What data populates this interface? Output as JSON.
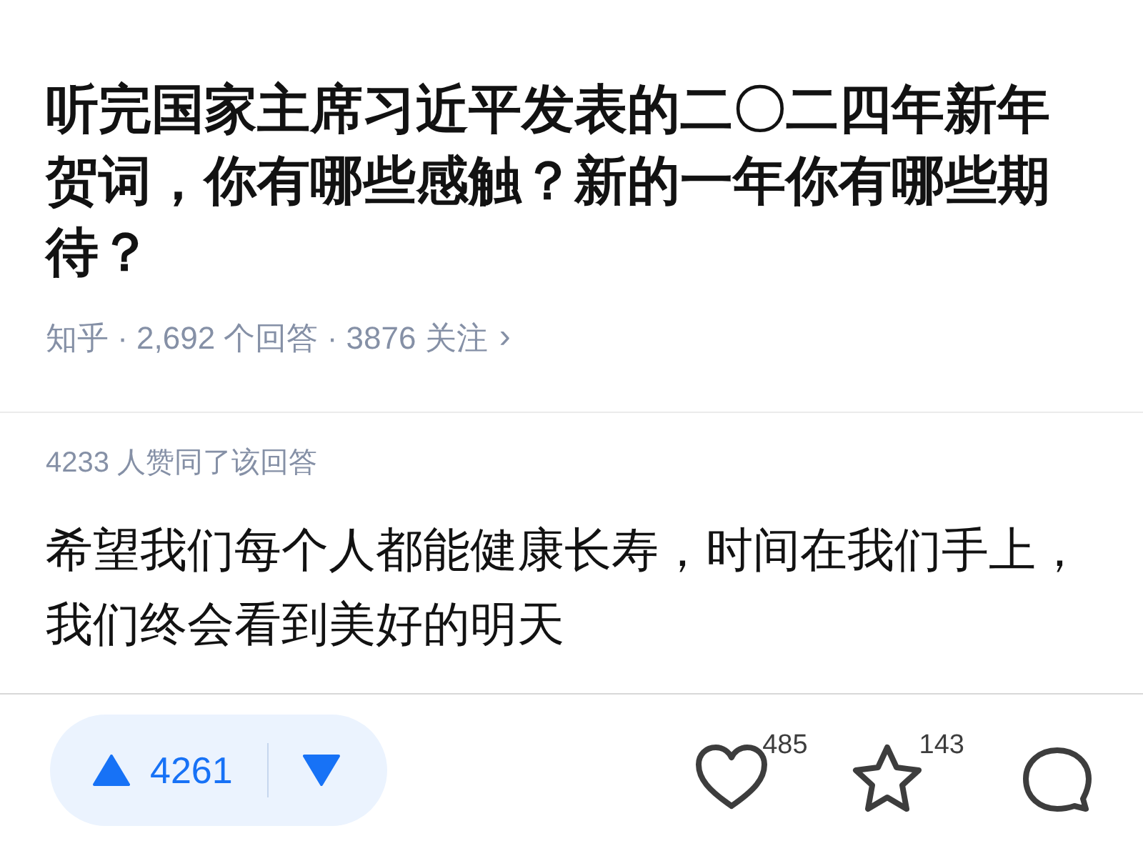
{
  "question": {
    "title": "听完国家主席习近平发表的二〇二四年新年贺词，你有哪些感触？新的一年你有哪些期待？",
    "meta": "知乎 · 2,692 个回答 · 3876 关注",
    "chevron": "›"
  },
  "answer": {
    "approval": "4233 人赞同了该回答",
    "text": "希望我们每个人都能健康长寿，时间在我们手上，我们终会看到美好的明天"
  },
  "actions": {
    "upvotes": "4261",
    "likes": "485",
    "favorites": "143"
  }
}
